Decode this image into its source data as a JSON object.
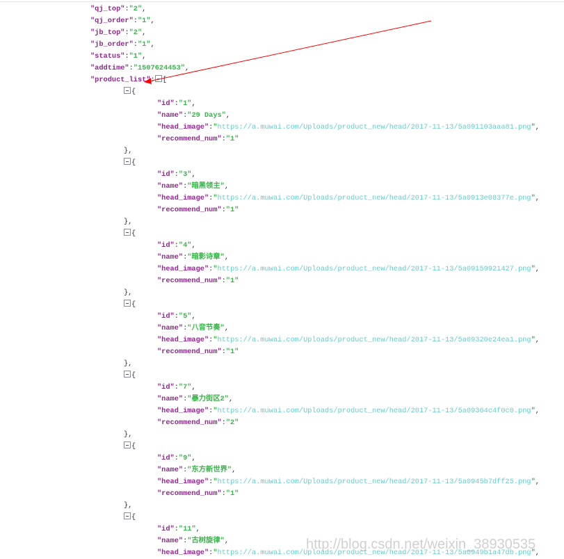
{
  "colors": {
    "key": "#92278f",
    "string": "#3ab54a",
    "url": "#66cccc",
    "annotation": "#ff0000"
  },
  "fields": [
    {
      "key": "qj_top",
      "value": "2"
    },
    {
      "key": "qj_order",
      "value": "1"
    },
    {
      "key": "jb_top",
      "value": "2"
    },
    {
      "key": "jb_order",
      "value": "1"
    },
    {
      "key": "status",
      "value": "1"
    },
    {
      "key": "addtime",
      "value": "1507624453"
    }
  ],
  "list_key": "product_list",
  "product_list": [
    {
      "id": "1",
      "name": "29 Days",
      "head_image": "https://a.muwai.com/Uploads/product_new/head/2017-11-13/5a091103aaa81.png",
      "recommend_num": "1"
    },
    {
      "id": "3",
      "name": "暗黑领主",
      "head_image": "https://a.muwai.com/Uploads/product_new/head/2017-11-13/5a0913e08377e.png",
      "recommend_num": "1"
    },
    {
      "id": "4",
      "name": "暗影诗章",
      "head_image": "https://a.muwai.com/Uploads/product_new/head/2017-11-13/5a09159921427.png",
      "recommend_num": "1"
    },
    {
      "id": "5",
      "name": "八音节奏",
      "head_image": "https://a.muwai.com/Uploads/product_new/head/2017-11-13/5a09320e24ea1.png",
      "recommend_num": "1"
    },
    {
      "id": "7",
      "name": "暴力街区2",
      "head_image": "https://a.muwai.com/Uploads/product_new/head/2017-11-13/5a09364c4f0c0.png",
      "recommend_num": "2"
    },
    {
      "id": "9",
      "name": "东方新世界",
      "head_image": "https://a.muwai.com/Uploads/product_new/head/2017-11-13/5a0945b7dff25.png",
      "recommend_num": "1"
    },
    {
      "id": "11",
      "name": "古树旋律",
      "head_image": "https://a.muwai.com/Uploads/product_new/head/2017-11-13/5a0949b1a47db.png"
    }
  ],
  "watermark": "http://blog.csdn.net/weixin_38930535"
}
